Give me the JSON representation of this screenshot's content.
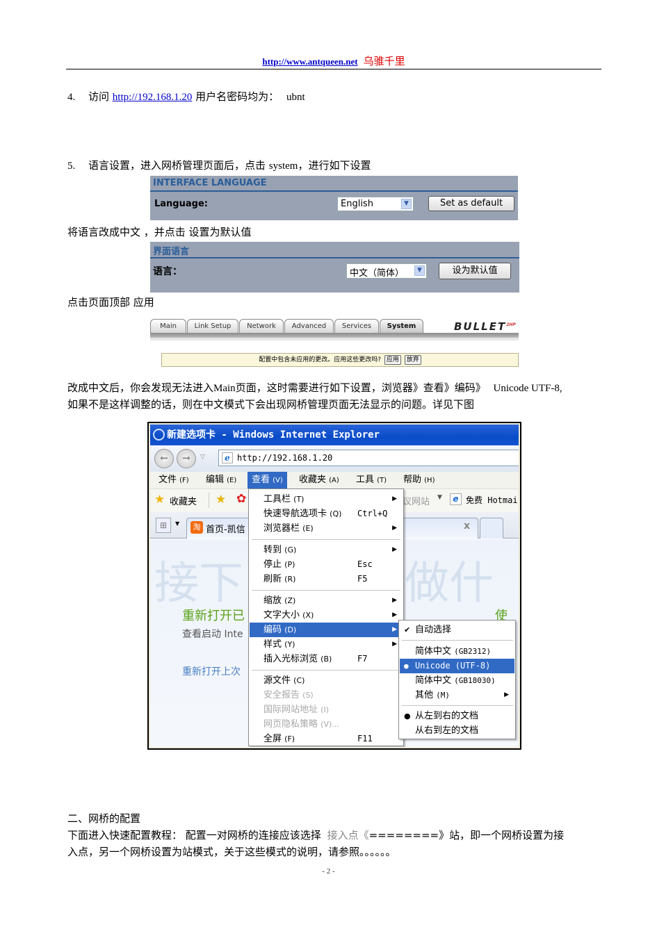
{
  "header": {
    "url": "http://www.antqueen.net",
    "brand": "乌骓千里"
  },
  "step4": {
    "num": "4.",
    "text_before": "访问",
    "link": "http://192.168.1.20",
    "text_after": "用户名密码均为：",
    "credential": "ubnt"
  },
  "step5": {
    "num": "5.",
    "text_before": "语言设置，进入网桥管理页面后，点击",
    "keyword": "system",
    "text_after": "，进行如下设置"
  },
  "panel_en": {
    "title": "INTERFACE LANGUAGE",
    "label": "Language:",
    "select_value": "English",
    "button": "Set as default"
  },
  "instruction_cn": "将语言改成中文 ，并点击 设置为默认值",
  "panel_cn": {
    "title": "界面语言",
    "label": "语言：",
    "select_value": "中文（简体）",
    "button": "设为默认值"
  },
  "instruction_apply": "点击页面顶部 应用",
  "bullet_nav": {
    "tabs": [
      "Main",
      "Link Setup",
      "Network",
      "Advanced",
      "Services",
      "System"
    ],
    "active_tab": "System",
    "logo": "BULLET",
    "logo_sup": "2HP",
    "notice": "配置中包含未应用的更改。应用这些更改吗?",
    "apply_button": "应用",
    "discard_button": "放弃"
  },
  "explain": {
    "line1_a": "改成中文后，你会发现无法进入",
    "line1_main": "Main",
    "line1_b": "页面，这时需要进行如下设置，浏览器》查看》编码》",
    "line1_utf": "Unicode UTF-8,",
    "line2": "如果不是这样调整的话，则在中文模式下会出现网桥管理页面无法显示的问题。详见下图"
  },
  "ie": {
    "title": "新建选项卡 - Windows Internet Explorer",
    "address": "http://192.168.1.20",
    "menubar": [
      {
        "label": "文件",
        "acc": "(F)"
      },
      {
        "label": "编辑",
        "acc": "(E)"
      },
      {
        "label": "查看",
        "acc": "(V)"
      },
      {
        "label": "收藏夹",
        "acc": "(A)"
      },
      {
        "label": "工具",
        "acc": "(T)"
      },
      {
        "label": "帮助",
        "acc": "(H)"
      }
    ],
    "favorites_label": "收藏夹",
    "suggested_sites": "议网站",
    "hotmail": "免费 Hotmai",
    "tab_label": "首页-凯信",
    "tab_close": "x",
    "content": {
      "watermark_left": "接下",
      "watermark_right": "做什么",
      "reopen_closed": "重新打开已",
      "view_startup": "查看启动 Inte",
      "reopen_last": "重新打开上次",
      "right_partial": "使用"
    },
    "view_menu": [
      {
        "label": "工具栏",
        "acc": "(T)",
        "shortcut": "",
        "submenu": true,
        "disabled": false
      },
      {
        "label": "快速导航选项卡",
        "acc": "(Q)",
        "shortcut": "Ctrl+Q",
        "submenu": false,
        "disabled": false
      },
      {
        "label": "浏览器栏",
        "acc": "(E)",
        "shortcut": "",
        "submenu": true,
        "disabled": false
      },
      {
        "label": "转到",
        "acc": "(G)",
        "shortcut": "",
        "submenu": true,
        "disabled": false
      },
      {
        "label": "停止",
        "acc": "(P)",
        "shortcut": "Esc",
        "submenu": false,
        "disabled": false
      },
      {
        "label": "刷新",
        "acc": "(R)",
        "shortcut": "F5",
        "submenu": false,
        "disabled": false
      },
      {
        "label": "缩放",
        "acc": "(Z)",
        "shortcut": "",
        "submenu": true,
        "disabled": false
      },
      {
        "label": "文字大小",
        "acc": "(X)",
        "shortcut": "",
        "submenu": true,
        "disabled": false
      },
      {
        "label": "编码",
        "acc": "(D)",
        "shortcut": "",
        "submenu": true,
        "disabled": false,
        "highlighted": true
      },
      {
        "label": "样式",
        "acc": "(Y)",
        "shortcut": "",
        "submenu": true,
        "disabled": false
      },
      {
        "label": "插入光标浏览",
        "acc": "(B)",
        "shortcut": "F7",
        "submenu": false,
        "disabled": false
      },
      {
        "label": "源文件",
        "acc": "(C)",
        "shortcut": "",
        "submenu": false,
        "disabled": false
      },
      {
        "label": "安全报告",
        "acc": "(S)",
        "shortcut": "",
        "submenu": false,
        "disabled": true
      },
      {
        "label": "国际网站地址",
        "acc": "(I)",
        "shortcut": "",
        "submenu": false,
        "disabled": true
      },
      {
        "label": "网页隐私策略",
        "acc": "(V)...",
        "shortcut": "",
        "submenu": false,
        "disabled": true
      },
      {
        "label": "全屏",
        "acc": "(F)",
        "shortcut": "F11",
        "submenu": false,
        "disabled": false
      }
    ],
    "encoding_menu": [
      {
        "label": "自动选择",
        "mark": "check"
      },
      {
        "label": "简体中文",
        "code": "(GB2312)",
        "mark": ""
      },
      {
        "label": "Unicode (UTF-8)",
        "mark": "dot",
        "highlighted": true
      },
      {
        "label": "简体中文",
        "code": "(GB18030)",
        "mark": ""
      },
      {
        "label": "其他",
        "code": "(M)",
        "mark": "",
        "submenu": true
      },
      {
        "label": "从左到右的文档",
        "mark": "dot"
      },
      {
        "label": "从右到左的文档",
        "mark": ""
      }
    ]
  },
  "section2": {
    "heading": "二、网桥的配置",
    "line1_a": "下面进入快速配置教程： 配置一对网桥的连接应该选择",
    "line1_hl": "接入点《",
    "line1_b": "========》站，即一个网桥设置为接",
    "line2": "入点，另一个网桥设置为站模式，关于这些模式的说明，请参照。。。。。。"
  },
  "page_number": "- 2 -"
}
